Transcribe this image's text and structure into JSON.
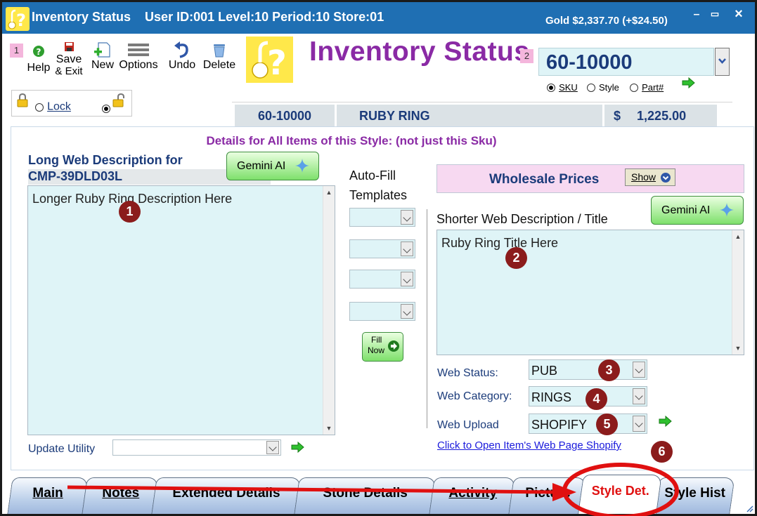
{
  "window": {
    "title": "Inventory Status",
    "session": "User ID:001 Level:10 Period:10 Store:01",
    "gold": "Gold $2,337.70 (+$24.50)",
    "minimize": "–",
    "maximize": "▭",
    "close": "×"
  },
  "toolbar": {
    "marker1": "1",
    "marker2": "2",
    "help_label": "Help",
    "save_top": "Save",
    "save_bottom": "& Exit",
    "new_label": "New",
    "options_label": "Options",
    "undo_label": "Undo",
    "delete_label": "Delete",
    "page_title": "Inventory Status"
  },
  "lookup": {
    "sku_value": "60-10000",
    "modes": [
      {
        "label": "SKU",
        "selected": true
      },
      {
        "label": "Style",
        "selected": false
      },
      {
        "label": "Part#",
        "selected": false
      }
    ]
  },
  "lock": {
    "lock_label": "Lock"
  },
  "item": {
    "sku": "60-10000",
    "name": "RUBY RING",
    "currency": "$",
    "price": "1,225.00"
  },
  "details": {
    "heading": "Details for All Items of this Style: (not just this Sku)",
    "long_label_line1": "Long Web Description for",
    "long_label_line2": "CMP-39DLD03L",
    "gemini_label": "Gemini AI",
    "long_text": "Longer Ruby Ring Description Here",
    "autofill_line1": "Auto-Fill",
    "autofill_line2": "Templates",
    "fill_line1": "Fill",
    "fill_line2": "Now",
    "wholesale_label": "Wholesale Prices",
    "show_label": "Show",
    "short_label": "Shorter Web Description /  Title",
    "short_text": "Ruby Ring Title Here",
    "web_status_label": "Web Status:",
    "web_status_value": "PUB",
    "web_category_label": "Web Category:",
    "web_category_value": "RINGS",
    "web_upload_label": "Web Upload",
    "web_upload_value": "SHOPIFY",
    "open_link": "Click to Open Item's Web Page Shopify",
    "update_label": "Update Utility"
  },
  "badges": [
    "1",
    "2",
    "3",
    "4",
    "5",
    "6"
  ],
  "tabs": [
    {
      "label": "Main",
      "active": false
    },
    {
      "label": "Notes",
      "active": false
    },
    {
      "label": "Extended Details",
      "active": false
    },
    {
      "label": "Stone Details",
      "active": false
    },
    {
      "label": "Activity",
      "active": false
    },
    {
      "label": "Picture",
      "active": false
    },
    {
      "label": "Style Det.",
      "active": true
    },
    {
      "label": "Style Hist",
      "active": false
    }
  ],
  "colors": {
    "titlebar": "#1f6fb3",
    "accent_purple": "#8a2aa5",
    "navy_text": "#1b3b7a",
    "field_bg": "#dff4f7",
    "badge": "#8b1c1c",
    "annotation_red": "#e01010"
  }
}
